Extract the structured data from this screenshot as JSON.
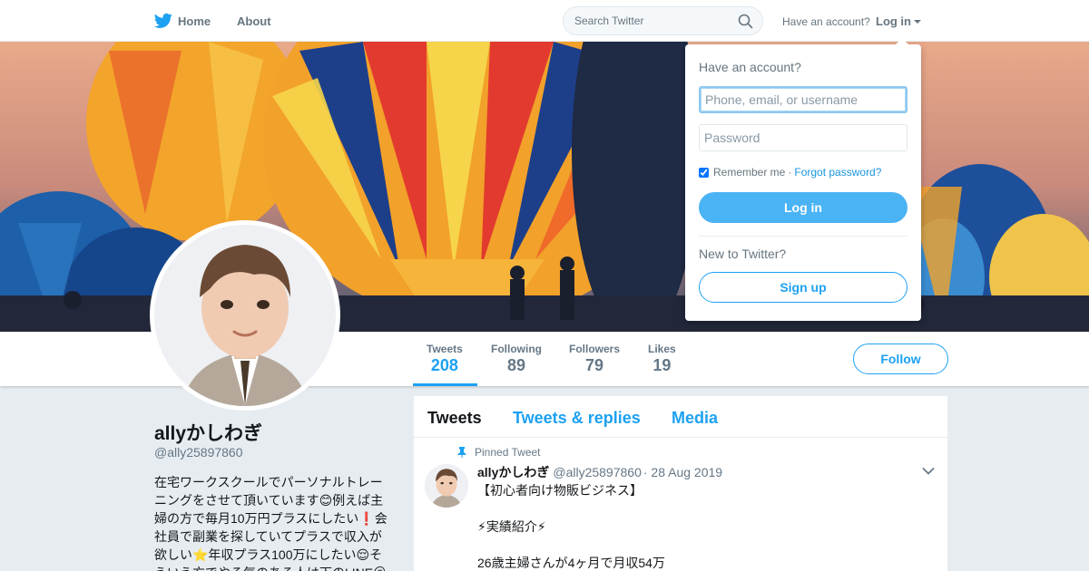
{
  "topbar": {
    "home_label": "Home",
    "about_label": "About",
    "search_placeholder": "Search Twitter",
    "have_account_label": "Have an account?",
    "login_label": "Log in"
  },
  "colors": {
    "accent": "#1da1f2",
    "login_button": "#4ab3f4",
    "page_background": "#e6ecf0"
  },
  "profile_nav": {
    "stats": [
      {
        "label": "Tweets",
        "value": "208"
      },
      {
        "label": "Following",
        "value": "89"
      },
      {
        "label": "Followers",
        "value": "79"
      },
      {
        "label": "Likes",
        "value": "19"
      }
    ],
    "follow_label": "Follow"
  },
  "profile": {
    "name": "allyかしわぎ",
    "handle": "@ally25897860",
    "bio": "在宅ワークスクールでパーソナルトレーニングをさせて頂いています😊例えば主婦の方で毎月10万円プラスにしたい❗会社員で副業を探していてプラスで収入が欲しい⭐年収プラス100万にしたい😌そういう方でやる気のある人は下のLINE＠"
  },
  "timeline": {
    "tabs": [
      "Tweets",
      "Tweets & replies",
      "Media"
    ],
    "pinned_label": "Pinned Tweet",
    "tweet": {
      "name": "allyかしわぎ",
      "handle": "@ally25897860",
      "date": "· 28 Aug 2019",
      "text": "【初心者向け物販ビジネス】\n\n⚡実績紹介⚡\n\n26歳主婦さんが4ヶ月で月収54万"
    }
  },
  "login_dropdown": {
    "title": "Have an account?",
    "username_placeholder": "Phone, email, or username",
    "password_placeholder": "Password",
    "remember_label": "Remember me",
    "separator": "·",
    "forgot_label": "Forgot password?",
    "login_button": "Log in",
    "new_label": "New to Twitter?",
    "signup_button": "Sign up"
  },
  "icons": [
    "twitter-bird-icon",
    "search-icon",
    "caret-down-icon",
    "pin-icon",
    "chevron-down-icon"
  ]
}
